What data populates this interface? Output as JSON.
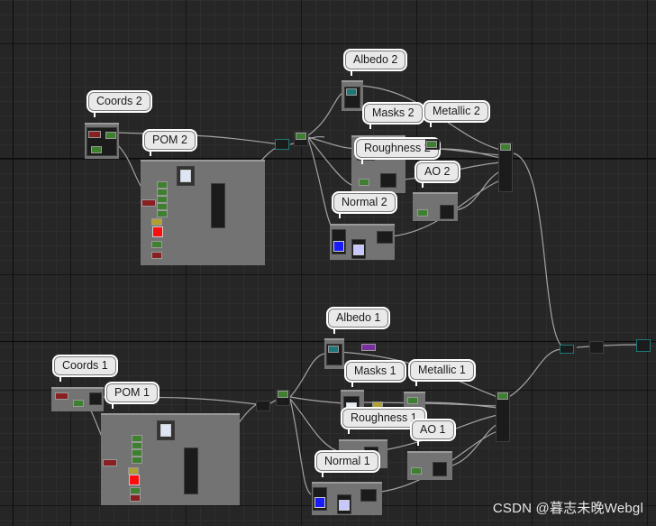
{
  "canvas": {
    "grid_color": "#2e2e2e",
    "background": "#262626"
  },
  "comments": {
    "albedo_2": "Albedo 2",
    "coords_2": "Coords 2",
    "masks_2": "Masks 2",
    "metallic_2": "Metallic 2",
    "pom_2": "POM 2",
    "roughness_2": "Roughness 2",
    "ao_2": "AO 2",
    "normal_2": "Normal 2",
    "albedo_1": "Albedo 1",
    "coords_1": "Coords 1",
    "pom_1": "POM 1",
    "masks_1": "Masks 1",
    "metallic_1": "Metallic 1",
    "roughness_1": "Roughness 1",
    "ao_1": "AO 1",
    "normal_1": "Normal 1"
  },
  "watermark": "CSDN @暮志未晚Webgl",
  "colors": {
    "wire": "#b9b9b9",
    "pin_green": "#3f7f30",
    "pin_red": "#8a1f22",
    "pin_teal": "#1e7777",
    "node_bg": "#1b1b1b"
  }
}
